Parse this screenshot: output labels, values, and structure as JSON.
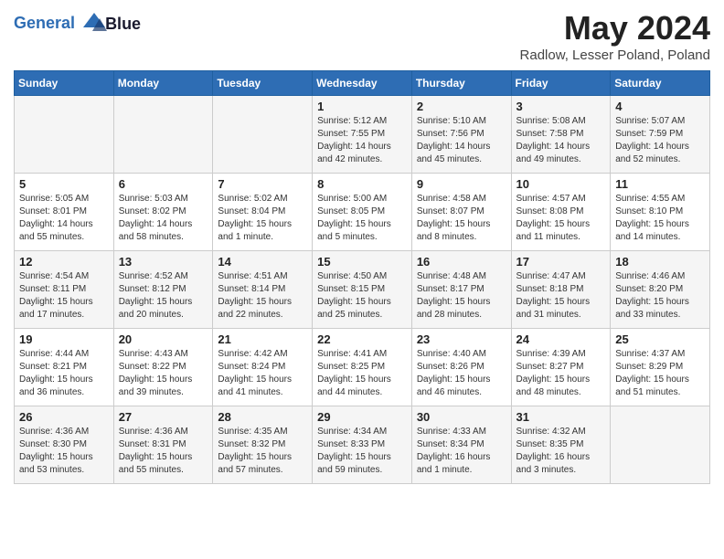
{
  "header": {
    "logo_line1": "General",
    "logo_line2": "Blue",
    "month_title": "May 2024",
    "location": "Radlow, Lesser Poland, Poland"
  },
  "weekdays": [
    "Sunday",
    "Monday",
    "Tuesday",
    "Wednesday",
    "Thursday",
    "Friday",
    "Saturday"
  ],
  "weeks": [
    [
      {
        "day": "",
        "sunrise": "",
        "sunset": "",
        "daylight": ""
      },
      {
        "day": "",
        "sunrise": "",
        "sunset": "",
        "daylight": ""
      },
      {
        "day": "",
        "sunrise": "",
        "sunset": "",
        "daylight": ""
      },
      {
        "day": "1",
        "sunrise": "Sunrise: 5:12 AM",
        "sunset": "Sunset: 7:55 PM",
        "daylight": "Daylight: 14 hours and 42 minutes."
      },
      {
        "day": "2",
        "sunrise": "Sunrise: 5:10 AM",
        "sunset": "Sunset: 7:56 PM",
        "daylight": "Daylight: 14 hours and 45 minutes."
      },
      {
        "day": "3",
        "sunrise": "Sunrise: 5:08 AM",
        "sunset": "Sunset: 7:58 PM",
        "daylight": "Daylight: 14 hours and 49 minutes."
      },
      {
        "day": "4",
        "sunrise": "Sunrise: 5:07 AM",
        "sunset": "Sunset: 7:59 PM",
        "daylight": "Daylight: 14 hours and 52 minutes."
      }
    ],
    [
      {
        "day": "5",
        "sunrise": "Sunrise: 5:05 AM",
        "sunset": "Sunset: 8:01 PM",
        "daylight": "Daylight: 14 hours and 55 minutes."
      },
      {
        "day": "6",
        "sunrise": "Sunrise: 5:03 AM",
        "sunset": "Sunset: 8:02 PM",
        "daylight": "Daylight: 14 hours and 58 minutes."
      },
      {
        "day": "7",
        "sunrise": "Sunrise: 5:02 AM",
        "sunset": "Sunset: 8:04 PM",
        "daylight": "Daylight: 15 hours and 1 minute."
      },
      {
        "day": "8",
        "sunrise": "Sunrise: 5:00 AM",
        "sunset": "Sunset: 8:05 PM",
        "daylight": "Daylight: 15 hours and 5 minutes."
      },
      {
        "day": "9",
        "sunrise": "Sunrise: 4:58 AM",
        "sunset": "Sunset: 8:07 PM",
        "daylight": "Daylight: 15 hours and 8 minutes."
      },
      {
        "day": "10",
        "sunrise": "Sunrise: 4:57 AM",
        "sunset": "Sunset: 8:08 PM",
        "daylight": "Daylight: 15 hours and 11 minutes."
      },
      {
        "day": "11",
        "sunrise": "Sunrise: 4:55 AM",
        "sunset": "Sunset: 8:10 PM",
        "daylight": "Daylight: 15 hours and 14 minutes."
      }
    ],
    [
      {
        "day": "12",
        "sunrise": "Sunrise: 4:54 AM",
        "sunset": "Sunset: 8:11 PM",
        "daylight": "Daylight: 15 hours and 17 minutes."
      },
      {
        "day": "13",
        "sunrise": "Sunrise: 4:52 AM",
        "sunset": "Sunset: 8:12 PM",
        "daylight": "Daylight: 15 hours and 20 minutes."
      },
      {
        "day": "14",
        "sunrise": "Sunrise: 4:51 AM",
        "sunset": "Sunset: 8:14 PM",
        "daylight": "Daylight: 15 hours and 22 minutes."
      },
      {
        "day": "15",
        "sunrise": "Sunrise: 4:50 AM",
        "sunset": "Sunset: 8:15 PM",
        "daylight": "Daylight: 15 hours and 25 minutes."
      },
      {
        "day": "16",
        "sunrise": "Sunrise: 4:48 AM",
        "sunset": "Sunset: 8:17 PM",
        "daylight": "Daylight: 15 hours and 28 minutes."
      },
      {
        "day": "17",
        "sunrise": "Sunrise: 4:47 AM",
        "sunset": "Sunset: 8:18 PM",
        "daylight": "Daylight: 15 hours and 31 minutes."
      },
      {
        "day": "18",
        "sunrise": "Sunrise: 4:46 AM",
        "sunset": "Sunset: 8:20 PM",
        "daylight": "Daylight: 15 hours and 33 minutes."
      }
    ],
    [
      {
        "day": "19",
        "sunrise": "Sunrise: 4:44 AM",
        "sunset": "Sunset: 8:21 PM",
        "daylight": "Daylight: 15 hours and 36 minutes."
      },
      {
        "day": "20",
        "sunrise": "Sunrise: 4:43 AM",
        "sunset": "Sunset: 8:22 PM",
        "daylight": "Daylight: 15 hours and 39 minutes."
      },
      {
        "day": "21",
        "sunrise": "Sunrise: 4:42 AM",
        "sunset": "Sunset: 8:24 PM",
        "daylight": "Daylight: 15 hours and 41 minutes."
      },
      {
        "day": "22",
        "sunrise": "Sunrise: 4:41 AM",
        "sunset": "Sunset: 8:25 PM",
        "daylight": "Daylight: 15 hours and 44 minutes."
      },
      {
        "day": "23",
        "sunrise": "Sunrise: 4:40 AM",
        "sunset": "Sunset: 8:26 PM",
        "daylight": "Daylight: 15 hours and 46 minutes."
      },
      {
        "day": "24",
        "sunrise": "Sunrise: 4:39 AM",
        "sunset": "Sunset: 8:27 PM",
        "daylight": "Daylight: 15 hours and 48 minutes."
      },
      {
        "day": "25",
        "sunrise": "Sunrise: 4:37 AM",
        "sunset": "Sunset: 8:29 PM",
        "daylight": "Daylight: 15 hours and 51 minutes."
      }
    ],
    [
      {
        "day": "26",
        "sunrise": "Sunrise: 4:36 AM",
        "sunset": "Sunset: 8:30 PM",
        "daylight": "Daylight: 15 hours and 53 minutes."
      },
      {
        "day": "27",
        "sunrise": "Sunrise: 4:36 AM",
        "sunset": "Sunset: 8:31 PM",
        "daylight": "Daylight: 15 hours and 55 minutes."
      },
      {
        "day": "28",
        "sunrise": "Sunrise: 4:35 AM",
        "sunset": "Sunset: 8:32 PM",
        "daylight": "Daylight: 15 hours and 57 minutes."
      },
      {
        "day": "29",
        "sunrise": "Sunrise: 4:34 AM",
        "sunset": "Sunset: 8:33 PM",
        "daylight": "Daylight: 15 hours and 59 minutes."
      },
      {
        "day": "30",
        "sunrise": "Sunrise: 4:33 AM",
        "sunset": "Sunset: 8:34 PM",
        "daylight": "Daylight: 16 hours and 1 minute."
      },
      {
        "day": "31",
        "sunrise": "Sunrise: 4:32 AM",
        "sunset": "Sunset: 8:35 PM",
        "daylight": "Daylight: 16 hours and 3 minutes."
      },
      {
        "day": "",
        "sunrise": "",
        "sunset": "",
        "daylight": ""
      }
    ]
  ]
}
